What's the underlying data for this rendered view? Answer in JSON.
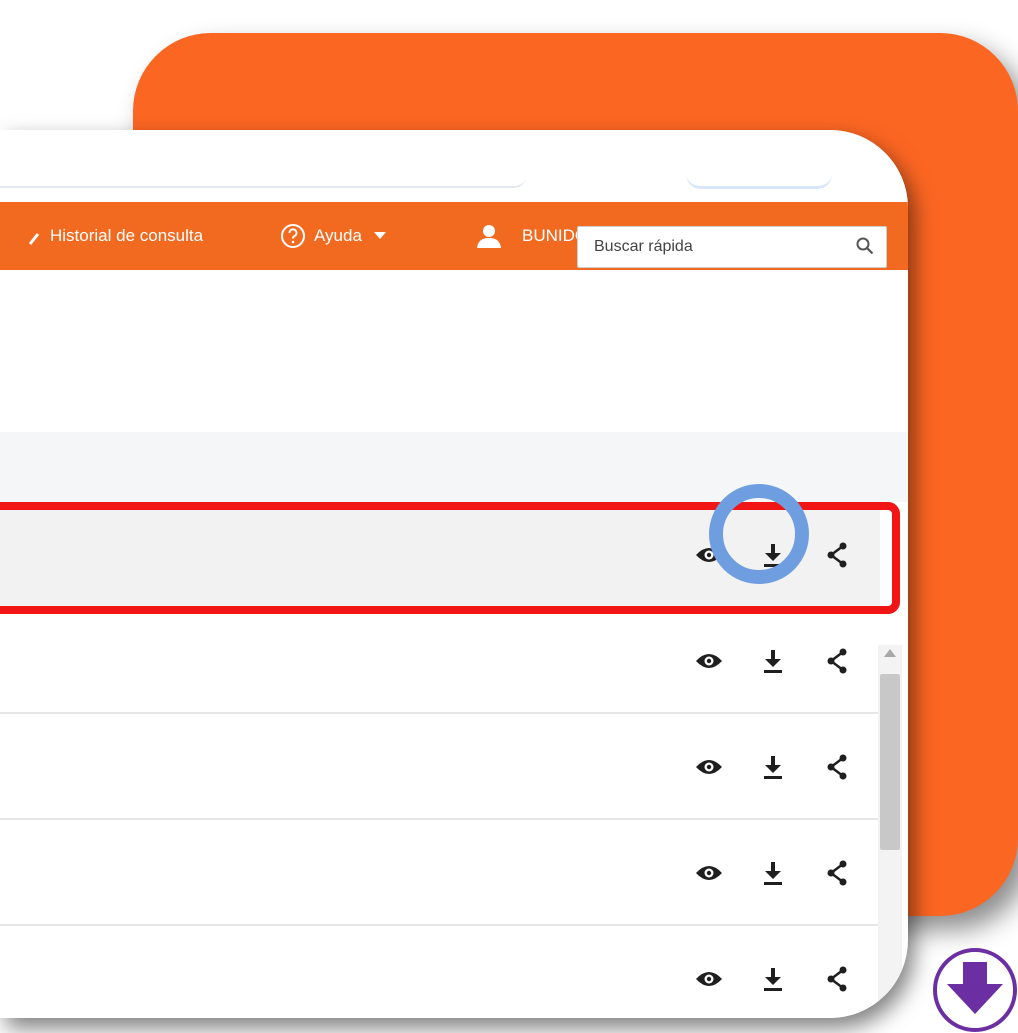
{
  "nav": {
    "history_label": "Historial de consulta",
    "help_label": "Ayuda",
    "user_label": "BUNIDOS PRUEBA, PEPITA AMEDERI"
  },
  "search": {
    "placeholder": "Buscar rápida"
  },
  "rows": [
    {
      "selected": true
    },
    {
      "selected": false
    },
    {
      "selected": false
    },
    {
      "selected": false
    },
    {
      "selected": false
    }
  ],
  "colors": {
    "navbar": "#f26a1f",
    "background_card": "#fc6623",
    "highlight_frame": "#f21515",
    "focus_ring": "#6f9ee0",
    "badge": "#6b2fa3"
  },
  "icons": [
    "search-icon",
    "help-circle-icon",
    "user-icon",
    "eye-icon",
    "download-icon",
    "share-icon",
    "arrow-down-icon"
  ]
}
